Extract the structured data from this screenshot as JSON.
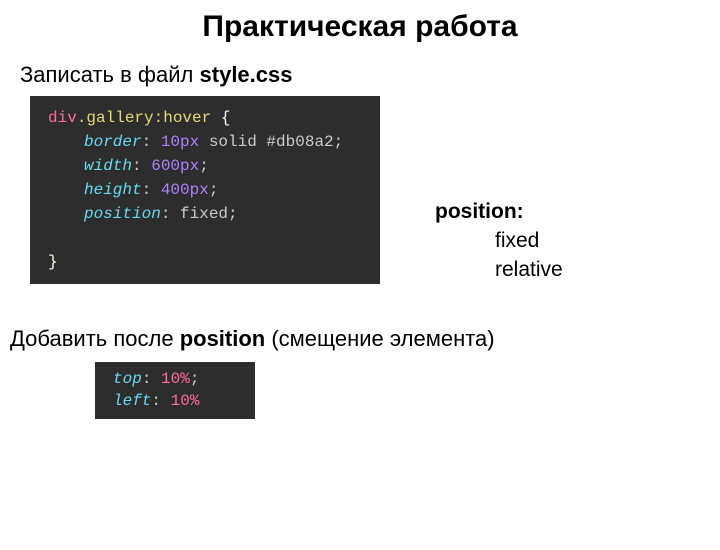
{
  "heading": "Практическая работа",
  "subheading": {
    "prefix": "Записать в файл ",
    "bold": "style.css"
  },
  "code1": {
    "selector_tag": "div",
    "selector_dot": ".gallery",
    "selector_pseudo": ":hover",
    "brace_open": " {",
    "border_prop": "border",
    "colon": ": ",
    "border_num": "10px",
    "border_val": " solid #db08a2",
    "semi": ";",
    "width_prop": "width",
    "width_val": "600px",
    "height_prop": "height",
    "height_val": "400px",
    "position_prop": "position",
    "position_val": " fixed",
    "brace_close": "}"
  },
  "side": {
    "label": "position:",
    "val1": "fixed",
    "val2": "relative"
  },
  "instruction2": {
    "prefix": "Добавить после ",
    "bold": "position",
    "suffix": " (смещение элемента)"
  },
  "code2": {
    "top_prop": "top",
    "colon": ": ",
    "top_val": "10%",
    "semi": ";",
    "left_prop": "left",
    "left_val": "10%"
  }
}
